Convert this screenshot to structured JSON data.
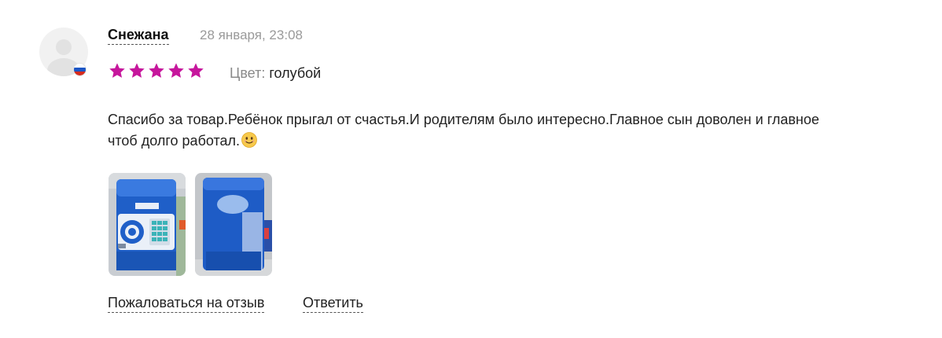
{
  "review": {
    "author": "Снежана",
    "date": "28 января, 23:08",
    "rating": 5,
    "rating_max": 5,
    "star_color": "#c6169c",
    "color_label": "Цвет:",
    "color_value": "голубой",
    "text": "Спасибо за товар.Ребёнок прыгал от счастья.И родителям было интересно.Главное сын доволен и главное чтоб долго работал.",
    "emoji_icon": "slightly-smiling-face-icon",
    "flag_icon": "russia-flag-icon",
    "photos": [
      {
        "icon": "piggy-bank-safe-front-photo"
      },
      {
        "icon": "piggy-bank-safe-back-photo"
      }
    ],
    "actions": {
      "complain": "Пожаловаться на отзыв",
      "reply": "Ответить"
    }
  }
}
